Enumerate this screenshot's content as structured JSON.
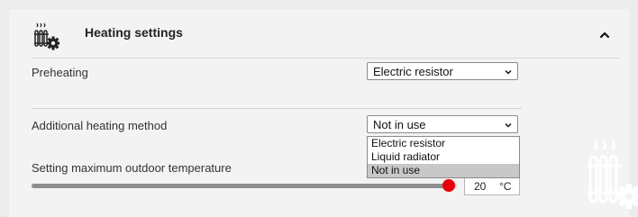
{
  "header": {
    "icon": "radiator-gear-icon",
    "title": "Heating settings",
    "collapse_icon": "chevron-up-icon"
  },
  "preheating": {
    "label": "Preheating",
    "selected": "Electric resistor"
  },
  "additional_heating": {
    "label": "Additional heating method",
    "selected": "Not in use",
    "options": [
      "Electric resistor",
      "Liquid radiator",
      "Not in use"
    ]
  },
  "max_outdoor_temp": {
    "label": "Setting maximum outdoor temperature",
    "value": "20",
    "unit": "°C",
    "slider_level_fraction": 0.98
  },
  "colors": {
    "slider_thumb": "#e8000b",
    "selected_option_bg": "#c8c8c8",
    "panel_bg": "#f3f3f3"
  },
  "decoration": {
    "watermark_icon": "radiator-gear-icon"
  }
}
